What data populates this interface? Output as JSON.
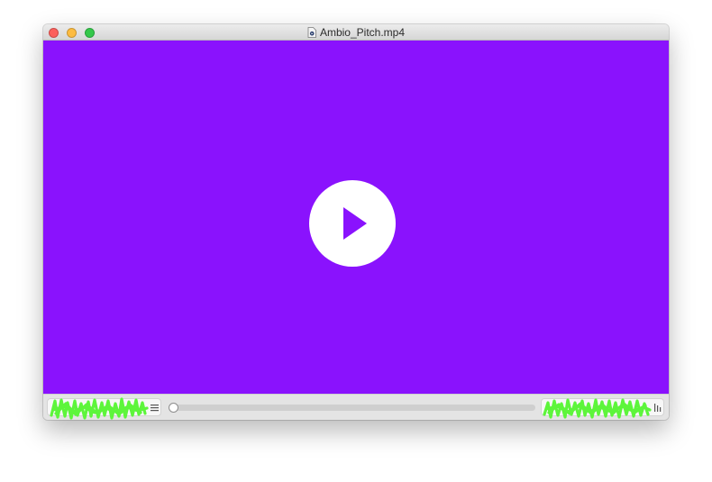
{
  "window": {
    "title": "Ambio_Pitch.mp4",
    "title_icon": "video-file-icon",
    "controls": {
      "close_color": "#fc605c",
      "minimize_color": "#fdbc40",
      "zoom_color": "#34c84a"
    }
  },
  "player": {
    "background_color": "#8a12fd",
    "play_button_icon": "play-icon",
    "play_icon_color": "#8a12fd",
    "progress_percent": 0,
    "scribble_color": "#5df53b",
    "left_controls_icon": "playlist-menu-icon",
    "right_controls_icon": "fullscreen-icon"
  }
}
